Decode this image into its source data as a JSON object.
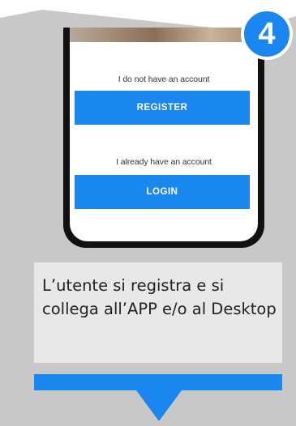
{
  "step": {
    "number": "4"
  },
  "phone": {
    "no_account_text": "I do not have an account",
    "register_label": "REGISTER",
    "have_account_text": "I already have an account",
    "login_label": "LOGIN"
  },
  "caption": {
    "text": "L’utente si registra e si collega all’APP e/o al Desktop"
  },
  "colors": {
    "accent": "#1a86f0",
    "panel_gray": "#c8c8c8",
    "caption_bg": "#e8e8e8"
  }
}
